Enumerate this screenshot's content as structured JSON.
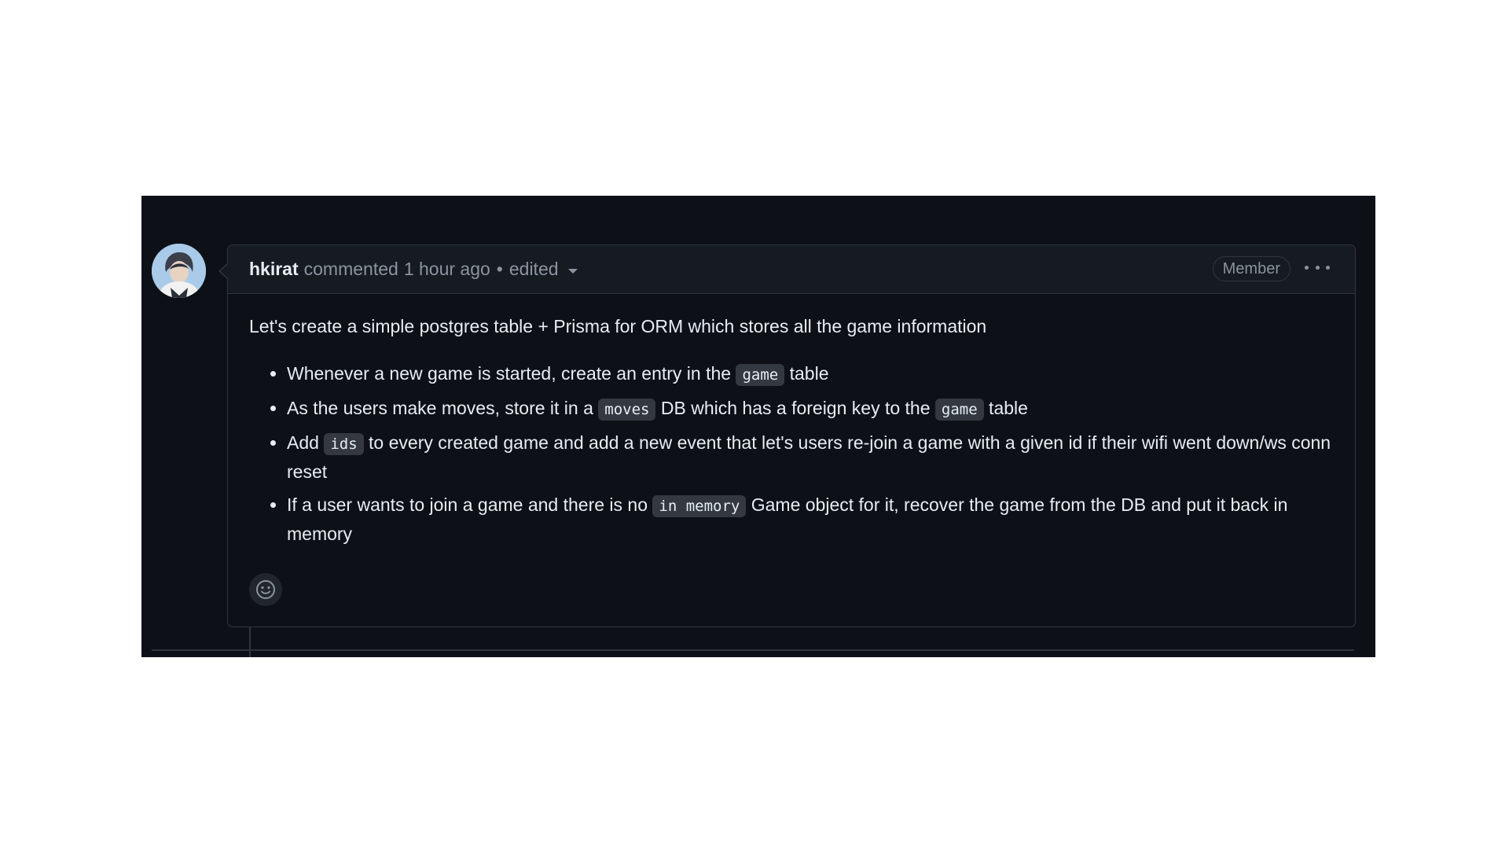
{
  "comment": {
    "author": "hkirat",
    "action": "commented",
    "time": "1 hour ago",
    "separator": "•",
    "edited": "edited",
    "badge": "Member",
    "intro": "Let's create a simple postgres table + Prisma for ORM which stores all the game information",
    "bullets": [
      {
        "parts": [
          "Whenever a new game is started, create an entry in the ",
          "game",
          " table"
        ]
      },
      {
        "parts": [
          "As the users make moves, store it in a ",
          "moves",
          " DB which has a foreign key to the ",
          "game",
          " table"
        ]
      },
      {
        "parts": [
          "Add ",
          "ids",
          " to every created game and add a new event that let's users re-join a game with a given id if their wifi went down/ws conn reset"
        ]
      },
      {
        "parts": [
          "If a user wants to join a game and there is no ",
          "in memory",
          " Game object for it, recover the game from the DB and put it back in memory"
        ]
      }
    ]
  },
  "icons": {
    "avatar": "user-avatar",
    "edit_menu": "chevron-down-icon",
    "more": "kebab-horizontal-icon",
    "reaction": "smiley-icon"
  },
  "colors": {
    "background": "#0d1117",
    "header": "#161b22",
    "border": "#30363d",
    "text": "#e6edf3",
    "muted": "#8b949e",
    "code_bg": "#343941"
  }
}
